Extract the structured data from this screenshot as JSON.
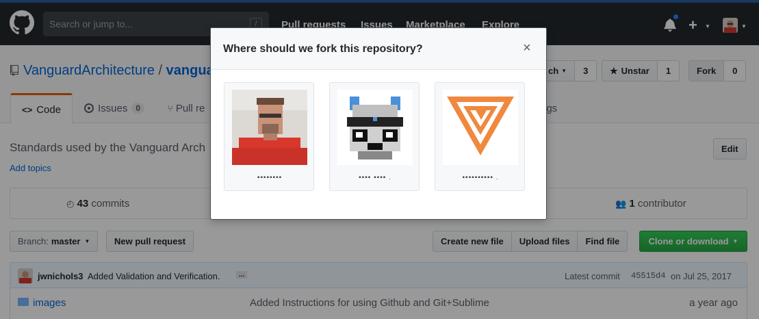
{
  "header": {
    "search_placeholder": "Search or jump to...",
    "search_shortcut": "/",
    "nav": [
      "Pull requests",
      "Issues",
      "Marketplace",
      "Explore"
    ]
  },
  "repo": {
    "owner": "VanguardArchitecture",
    "separator": "/",
    "name_fragment": "vangua",
    "watch_label": "ch",
    "watch_count": "3",
    "star_label": "Unstar",
    "star_count": "1",
    "fork_label": "Fork",
    "fork_count": "0"
  },
  "tabs": {
    "code": "Code",
    "issues": "Issues",
    "issues_count": "0",
    "pulls": "Pull re",
    "settings": "ngs"
  },
  "about": {
    "description": "Standards used by the Vanguard Arch",
    "add_topics": "Add topics",
    "edit": "Edit"
  },
  "stats": {
    "commits_count": "43",
    "commits_label": "commits",
    "contributors_count": "1",
    "contributors_label": "contributor"
  },
  "toolbar": {
    "branch_label": "Branch:",
    "branch_value": "master",
    "new_pr": "New pull request",
    "create_file": "Create new file",
    "upload": "Upload files",
    "find": "Find file",
    "clone": "Clone or download"
  },
  "commit": {
    "author": "jwnichols3",
    "message": "Added Validation and Verification.",
    "ellipsis": "...",
    "latest_label": "Latest commit",
    "sha": "45515d4",
    "date": "on Jul 25, 2017"
  },
  "files": [
    {
      "name": "images",
      "message": "Added Instructions for using Github and Git+Sublime",
      "age": "a year ago"
    }
  ],
  "modal": {
    "title": "Where should we fork this repository?",
    "close": "×",
    "targets": [
      {
        "name": "▪▪▪▪▪▪▪▪",
        "avatar": "user-photo-avatar"
      },
      {
        "name": "▪▪▪▪ ▪▪▪▪  .",
        "avatar": "robot-mascot-avatar"
      },
      {
        "name": "▪▪▪▪▪▪▪▪▪▪ .",
        "avatar": "v-logo-avatar"
      }
    ]
  },
  "colors": {
    "header_bg": "#24292e",
    "link": "#0366d6",
    "selected_tab": "#e36209",
    "clone_green": "#28a745",
    "logo_orange": "#f0883e"
  }
}
